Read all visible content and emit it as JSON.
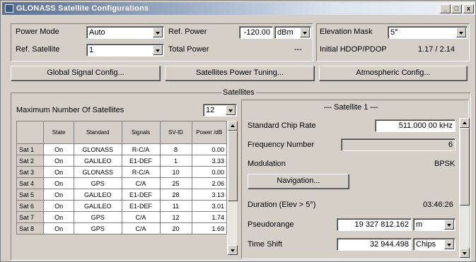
{
  "window": {
    "title": "GLONASS Satellite Configurations",
    "minimize": "_",
    "maximize": "□",
    "close": "x"
  },
  "top": {
    "power_mode_label": "Power Mode",
    "power_mode_value": "Auto",
    "ref_satellite_label": "Ref. Satellite",
    "ref_satellite_value": "1",
    "ref_power_label": "Ref. Power",
    "ref_power_value": "-120.00",
    "ref_power_unit": "dBm",
    "total_power_label": "Total Power",
    "total_power_value": "---",
    "elevation_mask_label": "Elevation Mask",
    "elevation_mask_value": "5°",
    "hdop_label": "Initial HDOP/PDOP",
    "hdop_value": "1.17 / 2.14"
  },
  "buttons": {
    "global_signal": "Global Signal Config...",
    "sat_power": "Satellites Power Tuning...",
    "atmospheric": "Atmospheric Config..."
  },
  "satellites_group": {
    "caption": "Satellites",
    "max_label": "Maximum Number Of Satellites",
    "max_value": "12",
    "columns": [
      "State",
      "Standard",
      "Signals",
      "SV-ID",
      "Power /dB"
    ],
    "rows": [
      {
        "name": "Sat 1",
        "state": "On",
        "standard": "GLONASS",
        "signals": "R-C/A",
        "svid": "8",
        "power": "0.00"
      },
      {
        "name": "Sat 2",
        "state": "On",
        "standard": "GALILEO",
        "signals": "E1-DEF",
        "svid": "1",
        "power": "3.33"
      },
      {
        "name": "Sat 3",
        "state": "On",
        "standard": "GLONASS",
        "signals": "R-C/A",
        "svid": "10",
        "power": "0.00"
      },
      {
        "name": "Sat 4",
        "state": "On",
        "standard": "GPS",
        "signals": "C/A",
        "svid": "25",
        "power": "2.06"
      },
      {
        "name": "Sat 5",
        "state": "On",
        "standard": "GALILEO",
        "signals": "E1-DEF",
        "svid": "28",
        "power": "3.13"
      },
      {
        "name": "Sat 6",
        "state": "On",
        "standard": "GALILEO",
        "signals": "E1-DEF",
        "svid": "11",
        "power": "3.01"
      },
      {
        "name": "Sat 7",
        "state": "On",
        "standard": "GPS",
        "signals": "C/A",
        "svid": "12",
        "power": "1.74"
      },
      {
        "name": "Sat 8",
        "state": "On",
        "standard": "GPS",
        "signals": "C/A",
        "svid": "20",
        "power": "1.69"
      }
    ]
  },
  "satellite_detail": {
    "header": "— Satellite 1 —",
    "chip_rate_label": "Standard Chip Rate",
    "chip_rate_value": "511.000 00 kHz",
    "freq_number_label": "Frequency Number",
    "freq_number_value": "6",
    "modulation_label": "Modulation",
    "modulation_value": "BPSK",
    "navigation_button": "Navigation...",
    "duration_label": "Duration (Elev > 5°)",
    "duration_value": "03:46:26",
    "pseudorange_label": "Pseudorange",
    "pseudorange_value": "19 327 812.162",
    "pseudorange_unit": "m",
    "time_shift_label": "Time Shift",
    "time_shift_value": "32 944.498",
    "time_shift_unit": "Chips"
  }
}
